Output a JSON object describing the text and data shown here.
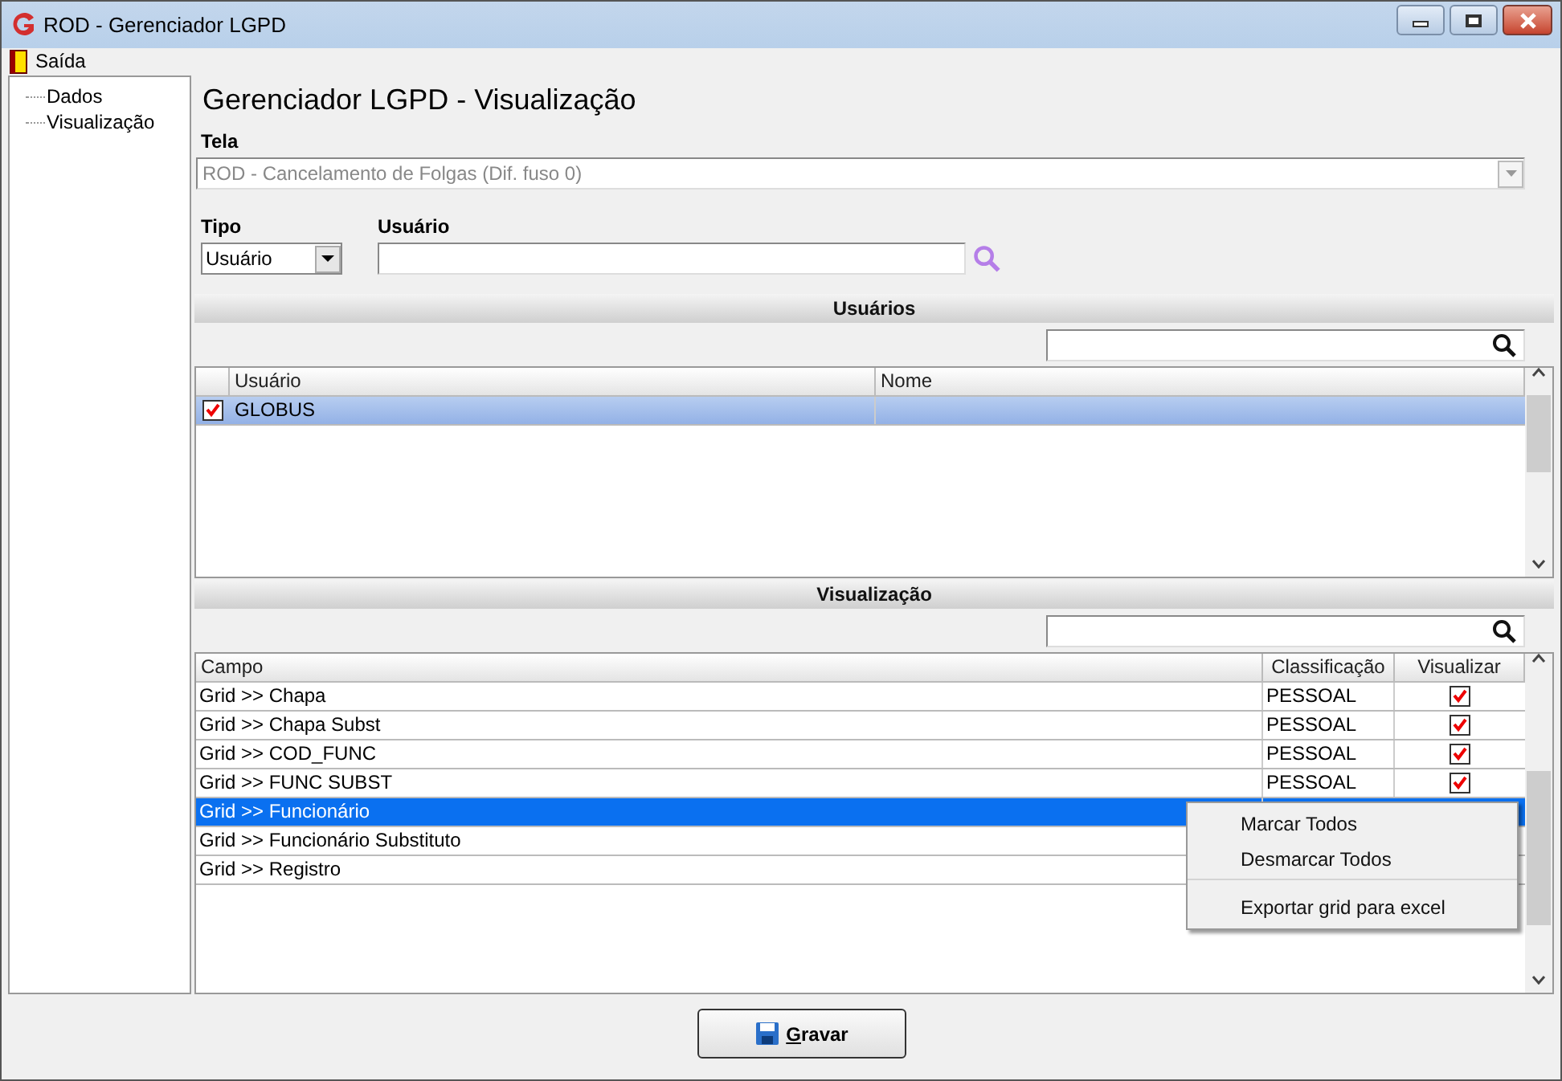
{
  "window": {
    "title": "ROD - Gerenciador LGPD"
  },
  "menu": [
    "Saída"
  ],
  "tree": [
    {
      "label": "Dados"
    },
    {
      "label": "Visualização"
    }
  ],
  "heading": "Gerenciador LGPD - Visualização",
  "tela": {
    "label": "Tela",
    "value": "ROD - Cancelamento de Folgas (Dif. fuso 0)",
    "disabled": true
  },
  "tipo": {
    "label": "Tipo",
    "value": "Usuário"
  },
  "usuario": {
    "label": "Usuário"
  },
  "users_section": {
    "title": "Usuários",
    "columns": [
      "Usuário",
      "Nome"
    ],
    "rows": [
      {
        "usuario": "GLOBUS",
        "checked": true,
        "selected": true
      }
    ]
  },
  "view_section": {
    "title": "Visualização",
    "columns": [
      "Campo",
      "Classificação",
      "Visualizar"
    ],
    "rows": [
      {
        "campo": "Grid >> Chapa",
        "classificacao": "PESSOAL",
        "visualizar": true,
        "selected": false
      },
      {
        "campo": "Grid >> Chapa Subst",
        "classificacao": "PESSOAL",
        "visualizar": true,
        "selected": false
      },
      {
        "campo": "Grid >> COD_FUNC",
        "classificacao": "PESSOAL",
        "visualizar": true,
        "selected": false
      },
      {
        "campo": "Grid >> FUNC SUBST",
        "classificacao": "PESSOAL",
        "visualizar": true,
        "selected": false
      },
      {
        "campo": "Grid >> Funcionário",
        "selected": true
      },
      {
        "campo": "Grid >> Funcionário Substituto",
        "selected": false
      },
      {
        "campo": "Grid >> Registro",
        "selected": false
      }
    ]
  },
  "context_menu": [
    {
      "label": "Marcar Todos",
      "separator_before": false
    },
    {
      "label": "Desmarcar Todos",
      "separator_before": false
    },
    {
      "label": "Exportar grid para excel",
      "separator_before": true
    }
  ],
  "save_button": "Gravar"
}
